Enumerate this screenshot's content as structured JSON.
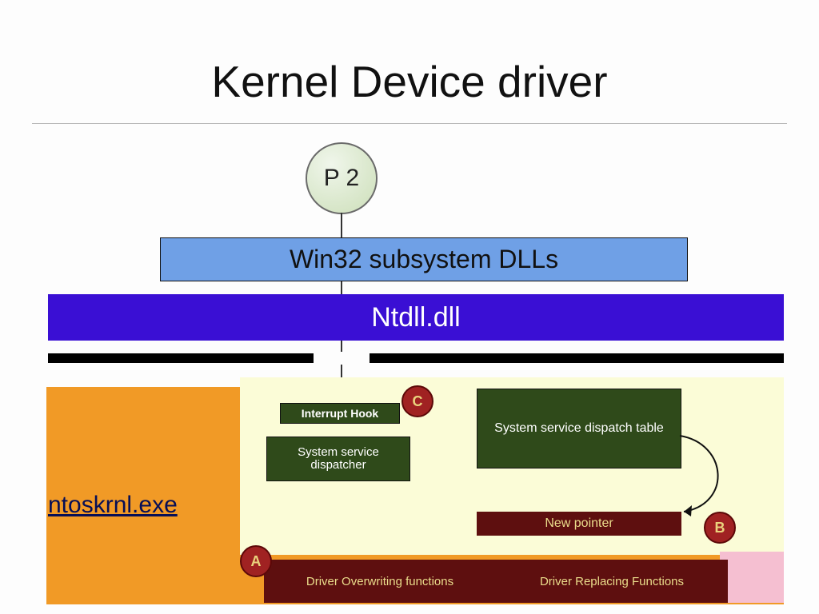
{
  "title": "Kernel Device driver",
  "nodes": {
    "p2": "P 2",
    "win32": "Win32 subsystem DLLs",
    "ntdll": "Ntdll.dll",
    "ntoskrnl": "ntoskrnl.exe",
    "interrupt_hook": "Interrupt Hook",
    "system_service_dispatcher": "System service dispatcher",
    "system_service_dispatch_table": "System service dispatch table",
    "new_pointer": "New pointer",
    "driver_overwriting": "Driver Overwriting functions",
    "driver_replacing": "Driver Replacing Functions"
  },
  "labels": {
    "A": "A",
    "B": "B",
    "C": "C"
  },
  "colors": {
    "win32_bg": "#6fa0e6",
    "ntdll_bg": "#3a0fd4",
    "panel_orange": "#f19a26",
    "panel_yellow": "#fbfcd7",
    "dark_green": "#2f4a1a",
    "dark_red": "#5e0f0f",
    "label_circle": "#a02222",
    "pink": "#f5bfd1"
  }
}
